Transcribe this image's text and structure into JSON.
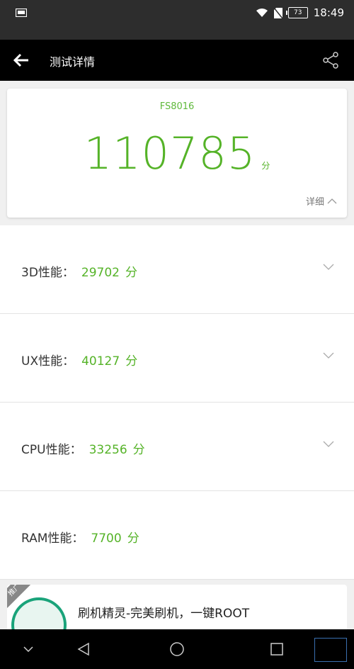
{
  "status_bar": {
    "battery": "73",
    "time": "18:49"
  },
  "header": {
    "title": "测试详情"
  },
  "score_card": {
    "device": "FS8016",
    "total_score": "110785",
    "unit": "分",
    "details_label": "详细"
  },
  "sections": [
    {
      "label": "3D性能：",
      "value": "29702",
      "unit": "分",
      "expandable": true
    },
    {
      "label": "UX性能：",
      "value": "40127",
      "unit": "分",
      "expandable": true
    },
    {
      "label": "CPU性能：",
      "value": "33256",
      "unit": "分",
      "expandable": true
    },
    {
      "label": "RAM性能：",
      "value": "7700",
      "unit": "分",
      "expandable": false
    }
  ],
  "ad": {
    "badge": "推广",
    "title": "刷机精灵-完美刷机，一键ROOT"
  },
  "colors": {
    "accent": "#55b328",
    "title_bar": "#000000",
    "status_bar": "#2d2d2d"
  }
}
